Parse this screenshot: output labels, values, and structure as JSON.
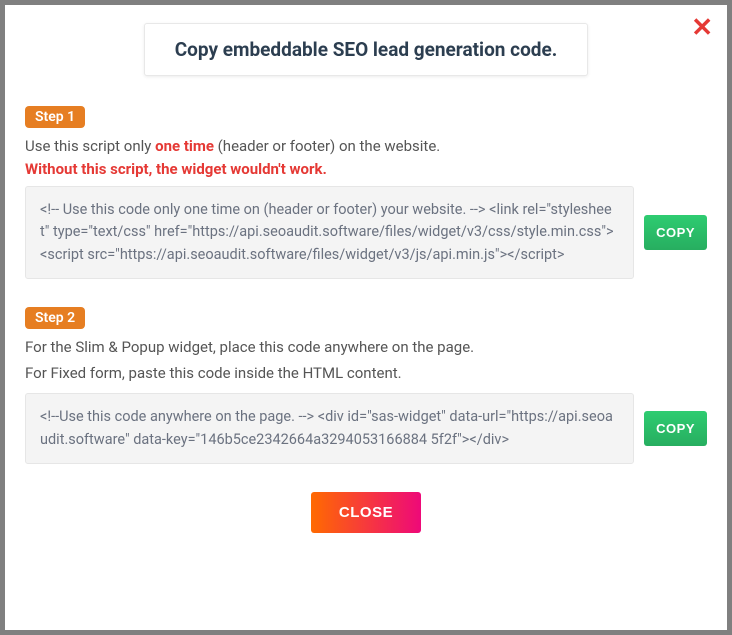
{
  "modal": {
    "title": "Copy embeddable SEO lead generation code.",
    "close_x": "✕"
  },
  "step1": {
    "badge": "Step 1",
    "instruction_pre": "Use this script only ",
    "instruction_emphasis": "one time",
    "instruction_post": " (header or footer) on the website.",
    "warning": "Without this script, the widget wouldn't work.",
    "code": "<!-- Use this code only one time on (header or footer) your website. --> <link rel=\"stylesheet\" type=\"text/css\" href=\"https://api.seoaudit.software/files/widget/v3/css/style.min.css\"> <script src=\"https://api.seoaudit.software/files/widget/v3/js/api.min.js\"></script>",
    "copy_label": "COPY"
  },
  "step2": {
    "badge": "Step 2",
    "instruction_line1": "For the Slim & Popup widget, place this code anywhere on the page.",
    "instruction_line2": "For Fixed form, paste this code inside the HTML content.",
    "code": "<!--Use this code anywhere on the page. --> <div id=\"sas-widget\" data-url=\"https://api.seoaudit.software\" data-key=\"146b5ce2342664a3294053166884 5f2f\"></div>",
    "copy_label": "COPY"
  },
  "footer": {
    "close_label": "CLOSE"
  }
}
